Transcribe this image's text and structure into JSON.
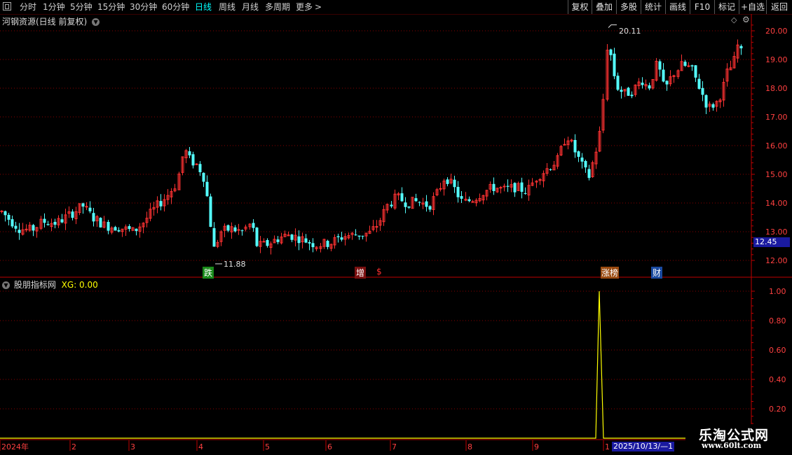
{
  "toolbar": {
    "periods": [
      "分时",
      "1分钟",
      "5分钟",
      "15分钟",
      "30分钟",
      "60分钟",
      "日线",
      "周线",
      "月线",
      "多周期",
      "更多"
    ],
    "active_period": "日线",
    "right_buttons": [
      "复权",
      "叠加",
      "多股",
      "统计",
      "画线",
      "F10",
      "标记",
      "+自选",
      "返回"
    ]
  },
  "main_chart": {
    "title": "河钢资源(日线 前复权)",
    "y_ticks": [
      "20.00",
      "19.00",
      "18.00",
      "17.00",
      "16.00",
      "15.00",
      "14.00",
      "13.00",
      "12.00"
    ],
    "current_price_label": "12.45",
    "high_annotation": "20.11",
    "low_annotation": "11.88",
    "markers": [
      "跌",
      "增",
      "$",
      "涨榜",
      "财"
    ]
  },
  "indicator": {
    "title": "股朋指标网",
    "value_label": "XG: 0.00",
    "y_ticks": [
      "1.00",
      "0.80",
      "0.60",
      "0.40",
      "0.20"
    ]
  },
  "x_axis": {
    "labels": [
      "2024年",
      "2",
      "3",
      "4",
      "5",
      "6",
      "7",
      "8",
      "9",
      "1"
    ],
    "cursor_label": "2025/10/13/—1"
  },
  "watermark": {
    "line1": "乐淘公式网",
    "line2": "www.60lt.com"
  },
  "chart_data": {
    "type": "candlestick",
    "ylim": [
      11.6,
      20.3
    ],
    "y_ticks": [
      20,
      19,
      18,
      17,
      16,
      15,
      14,
      13,
      12
    ],
    "high": 20.11,
    "low": 11.88,
    "last": 12.45,
    "indicator_series": {
      "name": "XG",
      "ylim": [
        0.1,
        1.05
      ],
      "values_desc": "0 everywhere except a single spike to 1.00 in late September",
      "spike_value": 1.0
    }
  },
  "colors": {
    "up": "#ff3232",
    "down": "#54ffff",
    "grid": "#8a0000",
    "axis": "#c00000",
    "indicator_line": "#ffff00"
  }
}
